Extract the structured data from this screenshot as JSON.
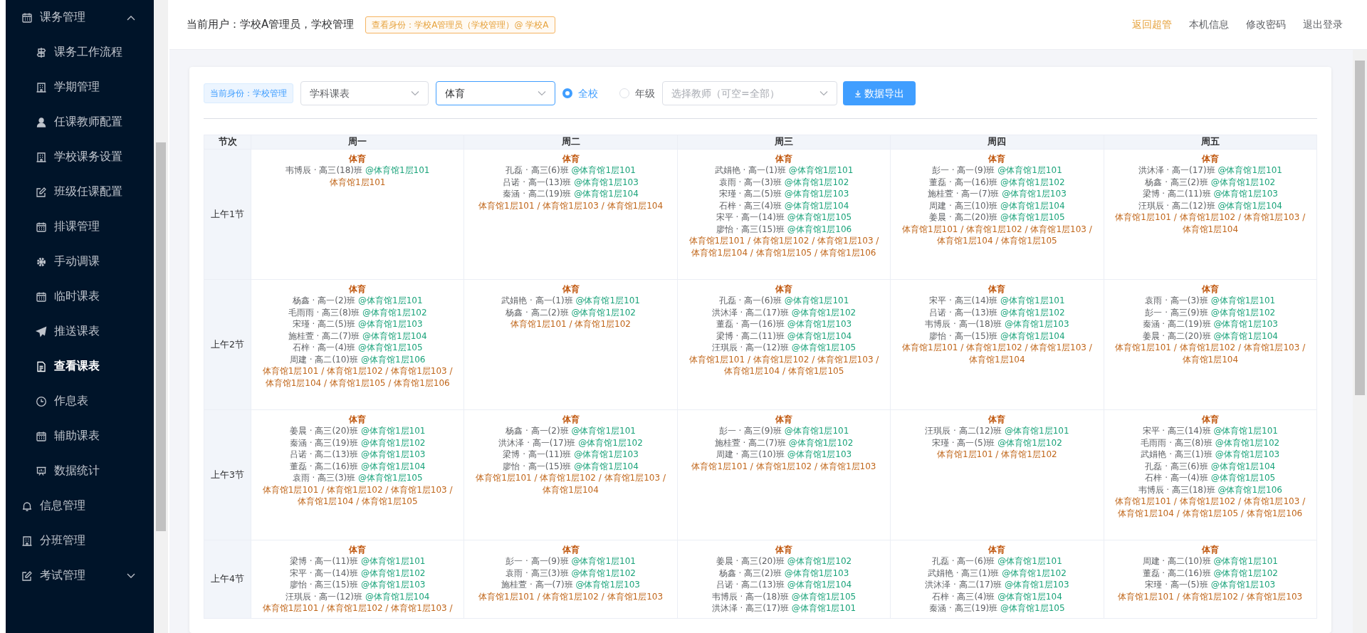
{
  "sidebar": {
    "items": [
      {
        "kind": "group",
        "label": "课务管理",
        "expanded": true,
        "selected": false,
        "children": [
          {
            "label": "课务工作流程",
            "selected": false
          },
          {
            "label": "学期管理",
            "selected": false
          },
          {
            "label": "任课教师配置",
            "selected": false
          },
          {
            "label": "学校课务设置",
            "selected": false
          },
          {
            "label": "班级任课配置",
            "selected": false
          },
          {
            "label": "排课管理",
            "selected": false
          },
          {
            "label": "手动调课",
            "selected": false
          },
          {
            "label": "临时课表",
            "selected": false
          },
          {
            "label": "推送课表",
            "selected": false
          },
          {
            "label": "查看课表",
            "selected": true
          },
          {
            "label": "作息表",
            "selected": false
          },
          {
            "label": "辅助课表",
            "selected": false
          },
          {
            "label": "数据统计",
            "selected": false
          }
        ]
      },
      {
        "kind": "link",
        "label": "信息管理",
        "selected": false
      },
      {
        "kind": "link",
        "label": "分班管理",
        "selected": false
      },
      {
        "kind": "group",
        "label": "考试管理",
        "expanded": false,
        "selected": false
      }
    ]
  },
  "header": {
    "user_text": "当前用户：学校A管理员，学校管理",
    "identity_badge": "查看身份：学校A管理员（学校管理）@ 学校A",
    "links": [
      {
        "label": "返回超管",
        "highlighted": true
      },
      {
        "label": "本机信息",
        "highlighted": false
      },
      {
        "label": "修改密码",
        "highlighted": false
      },
      {
        "label": "退出登录",
        "highlighted": false
      }
    ]
  },
  "toolbar": {
    "identity_tag": "当前身份：学校管理",
    "table_type": {
      "value": "学科课表",
      "focused": false
    },
    "subject": {
      "value": "体育",
      "focused": true
    },
    "scope": [
      {
        "label": "全校",
        "selected": true
      },
      {
        "label": "年级",
        "selected": false
      }
    ],
    "teacher": {
      "placeholder": "选择教师（可空=全部）"
    },
    "export_button": "数据导出"
  },
  "table": {
    "period_header": "节次",
    "columns": [
      "周一",
      "周二",
      "周三",
      "周四",
      "周五"
    ],
    "rows": [
      {
        "period": "上午1节",
        "cells": [
          {
            "subject": "体育",
            "entries": [
              {
                "who": "韦博辰 · 高三(18)班",
                "room": "@体育馆1层101"
              }
            ],
            "rooms": "体育馆1层101"
          },
          {
            "subject": "体育",
            "entries": [
              {
                "who": "孔磊 · 高三(6)班",
                "room": "@体育馆1层101"
              },
              {
                "who": "吕诺 · 高一(13)班",
                "room": "@体育馆1层103"
              },
              {
                "who": "秦涵 · 高二(19)班",
                "room": "@体育馆1层104"
              }
            ],
            "rooms": "体育馆1层101 / 体育馆1层103 / 体育馆1层104"
          },
          {
            "subject": "体育",
            "entries": [
              {
                "who": "武娟艳 · 高一(1)班",
                "room": "@体育馆1层101"
              },
              {
                "who": "袁雨 · 高一(3)班",
                "room": "@体育馆1层102"
              },
              {
                "who": "宋瑾 · 高二(5)班",
                "room": "@体育馆1层103"
              },
              {
                "who": "石梓 · 高三(4)班",
                "room": "@体育馆1层104"
              },
              {
                "who": "宋平 · 高一(14)班",
                "room": "@体育馆1层105"
              },
              {
                "who": "廖怡 · 高三(15)班",
                "room": "@体育馆1层106"
              }
            ],
            "rooms": "体育馆1层101 / 体育馆1层102 / 体育馆1层103 / 体育馆1层104 / 体育馆1层105 / 体育馆1层106"
          },
          {
            "subject": "体育",
            "entries": [
              {
                "who": "彭一 · 高一(9)班",
                "room": "@体育馆1层101"
              },
              {
                "who": "董磊 · 高一(16)班",
                "room": "@体育馆1层102"
              },
              {
                "who": "施桂萱 · 高一(7)班",
                "room": "@体育馆1层103"
              },
              {
                "who": "周建 · 高三(10)班",
                "room": "@体育馆1层104"
              },
              {
                "who": "姜晨 · 高二(20)班",
                "room": "@体育馆1层105"
              }
            ],
            "rooms": "体育馆1层101 / 体育馆1层102 / 体育馆1层103 / 体育馆1层104 / 体育馆1层105"
          },
          {
            "subject": "体育",
            "entries": [
              {
                "who": "洪沐泽 · 高一(17)班",
                "room": "@体育馆1层101"
              },
              {
                "who": "杨鑫 · 高三(2)班",
                "room": "@体育馆1层102"
              },
              {
                "who": "梁博 · 高二(11)班",
                "room": "@体育馆1层103"
              },
              {
                "who": "汪琪辰 · 高二(12)班",
                "room": "@体育馆1层104"
              }
            ],
            "rooms": "体育馆1层101 / 体育馆1层102 / 体育馆1层103 / 体育馆1层104"
          }
        ]
      },
      {
        "period": "上午2节",
        "cells": [
          {
            "subject": "体育",
            "entries": [
              {
                "who": "杨鑫 · 高一(2)班",
                "room": "@体育馆1层101"
              },
              {
                "who": "毛雨雨 · 高三(8)班",
                "room": "@体育馆1层102"
              },
              {
                "who": "宋瑾 · 高二(5)班",
                "room": "@体育馆1层103"
              },
              {
                "who": "施桂萱 · 高二(7)班",
                "room": "@体育馆1层104"
              },
              {
                "who": "石梓 · 高一(4)班",
                "room": "@体育馆1层105"
              },
              {
                "who": "周建 · 高二(10)班",
                "room": "@体育馆1层106"
              }
            ],
            "rooms": "体育馆1层101 / 体育馆1层102 / 体育馆1层103 / 体育馆1层104 / 体育馆1层105 / 体育馆1层106"
          },
          {
            "subject": "体育",
            "entries": [
              {
                "who": "武娟艳 · 高一(1)班",
                "room": "@体育馆1层101"
              },
              {
                "who": "杨鑫 · 高二(2)班",
                "room": "@体育馆1层102"
              }
            ],
            "rooms": "体育馆1层101 / 体育馆1层102"
          },
          {
            "subject": "体育",
            "entries": [
              {
                "who": "孔磊 · 高一(6)班",
                "room": "@体育馆1层101"
              },
              {
                "who": "洪沐泽 · 高二(17)班",
                "room": "@体育馆1层102"
              },
              {
                "who": "董磊 · 高一(16)班",
                "room": "@体育馆1层103"
              },
              {
                "who": "梁博 · 高二(11)班",
                "room": "@体育馆1层104"
              },
              {
                "who": "汪琪辰 · 高一(12)班",
                "room": "@体育馆1层105"
              }
            ],
            "rooms": "体育馆1层101 / 体育馆1层102 / 体育馆1层103 / 体育馆1层104 / 体育馆1层105"
          },
          {
            "subject": "体育",
            "entries": [
              {
                "who": "宋平 · 高三(14)班",
                "room": "@体育馆1层101"
              },
              {
                "who": "吕诺 · 高一(13)班",
                "room": "@体育馆1层102"
              },
              {
                "who": "韦博辰 · 高一(18)班",
                "room": "@体育馆1层103"
              },
              {
                "who": "廖怡 · 高一(15)班",
                "room": "@体育馆1层104"
              }
            ],
            "rooms": "体育馆1层101 / 体育馆1层102 / 体育馆1层103 / 体育馆1层104"
          },
          {
            "subject": "体育",
            "entries": [
              {
                "who": "袁雨 · 高一(3)班",
                "room": "@体育馆1层101"
              },
              {
                "who": "彭一 · 高三(9)班",
                "room": "@体育馆1层102"
              },
              {
                "who": "秦涵 · 高二(19)班",
                "room": "@体育馆1层103"
              },
              {
                "who": "姜晨 · 高二(20)班",
                "room": "@体育馆1层104"
              }
            ],
            "rooms": "体育馆1层101 / 体育馆1层102 / 体育馆1层103 / 体育馆1层104"
          }
        ]
      },
      {
        "period": "上午3节",
        "cells": [
          {
            "subject": "体育",
            "entries": [
              {
                "who": "姜晨 · 高三(20)班",
                "room": "@体育馆1层101"
              },
              {
                "who": "秦涵 · 高三(19)班",
                "room": "@体育馆1层102"
              },
              {
                "who": "吕诺 · 高二(13)班",
                "room": "@体育馆1层103"
              },
              {
                "who": "董磊 · 高二(16)班",
                "room": "@体育馆1层104"
              },
              {
                "who": "袁雨 · 高三(3)班",
                "room": "@体育馆1层105"
              }
            ],
            "rooms": "体育馆1层101 / 体育馆1层102 / 体育馆1层103 / 体育馆1层104 / 体育馆1层105"
          },
          {
            "subject": "体育",
            "entries": [
              {
                "who": "杨鑫 · 高一(2)班",
                "room": "@体育馆1层101"
              },
              {
                "who": "洪沐泽 · 高一(17)班",
                "room": "@体育馆1层102"
              },
              {
                "who": "梁博 · 高一(11)班",
                "room": "@体育馆1层103"
              },
              {
                "who": "廖怡 · 高一(15)班",
                "room": "@体育馆1层104"
              }
            ],
            "rooms": "体育馆1层101 / 体育馆1层102 / 体育馆1层103 / 体育馆1层104"
          },
          {
            "subject": "体育",
            "entries": [
              {
                "who": "彭一 · 高三(9)班",
                "room": "@体育馆1层101"
              },
              {
                "who": "施桂萱 · 高二(7)班",
                "room": "@体育馆1层102"
              },
              {
                "who": "周建 · 高三(10)班",
                "room": "@体育馆1层103"
              }
            ],
            "rooms": "体育馆1层101 / 体育馆1层102 / 体育馆1层103"
          },
          {
            "subject": "体育",
            "entries": [
              {
                "who": "汪琪辰 · 高二(12)班",
                "room": "@体育馆1层101"
              },
              {
                "who": "宋瑾 · 高一(5)班",
                "room": "@体育馆1层102"
              }
            ],
            "rooms": "体育馆1层101 / 体育馆1层102"
          },
          {
            "subject": "体育",
            "entries": [
              {
                "who": "宋平 · 高三(14)班",
                "room": "@体育馆1层101"
              },
              {
                "who": "毛雨雨 · 高三(8)班",
                "room": "@体育馆1层102"
              },
              {
                "who": "武娟艳 · 高三(1)班",
                "room": "@体育馆1层103"
              },
              {
                "who": "孔磊 · 高三(6)班",
                "room": "@体育馆1层104"
              },
              {
                "who": "石梓 · 高一(4)班",
                "room": "@体育馆1层105"
              },
              {
                "who": "韦博辰 · 高三(18)班",
                "room": "@体育馆1层106"
              }
            ],
            "rooms": "体育馆1层101 / 体育馆1层102 / 体育馆1层103 / 体育馆1层104 / 体育馆1层105 / 体育馆1层106"
          }
        ]
      },
      {
        "period": "上午4节",
        "cells": [
          {
            "subject": "体育",
            "entries": [
              {
                "who": "梁博 · 高一(11)班",
                "room": "@体育馆1层101"
              },
              {
                "who": "宋平 · 高一(14)班",
                "room": "@体育馆1层102"
              },
              {
                "who": "廖怡 · 高三(15)班",
                "room": "@体育馆1层103"
              },
              {
                "who": "汪琪辰 · 高一(12)班",
                "room": "@体育馆1层104"
              }
            ],
            "rooms": "体育馆1层101 / 体育馆1层102 / 体育馆1层103 /"
          },
          {
            "subject": "体育",
            "entries": [
              {
                "who": "彭一 · 高一(9)班",
                "room": "@体育馆1层101"
              },
              {
                "who": "袁雨 · 高三(3)班",
                "room": "@体育馆1层102"
              },
              {
                "who": "施桂萱 · 高一(7)班",
                "room": "@体育馆1层103"
              }
            ],
            "rooms": "体育馆1层101 / 体育馆1层102 / 体育馆1层103"
          },
          {
            "subject": "体育",
            "entries": [
              {
                "who": "姜晨 · 高三(20)班",
                "room": "@体育馆1层102"
              },
              {
                "who": "杨鑫 · 高三(2)班",
                "room": "@体育馆1层103"
              },
              {
                "who": "吕诺 · 高二(13)班",
                "room": "@体育馆1层104"
              },
              {
                "who": "韦博辰 · 高一(18)班",
                "room": "@体育馆1层105"
              },
              {
                "who": "洪沐泽 · 高三(17)班",
                "room": "@体育馆1层101"
              }
            ]
          },
          {
            "subject": "体育",
            "entries": [
              {
                "who": "孔磊 · 高一(6)班",
                "room": "@体育馆1层101"
              },
              {
                "who": "武娟艳 · 高三(1)班",
                "room": "@体育馆1层102"
              },
              {
                "who": "洪沐泽 · 高二(17)班",
                "room": "@体育馆1层103"
              },
              {
                "who": "石梓 · 高三(4)班",
                "room": "@体育馆1层104"
              },
              {
                "who": "秦涵 · 高三(19)班",
                "room": "@体育馆1层105"
              }
            ]
          },
          {
            "subject": "体育",
            "entries": [
              {
                "who": "周建 · 高二(10)班",
                "room": "@体育馆1层101"
              },
              {
                "who": "董磊 · 高二(16)班",
                "room": "@体育馆1层102"
              },
              {
                "who": "宋瑾 · 高一(5)班",
                "room": "@体育馆1层103"
              }
            ],
            "rooms": "体育馆1层101 / 体育馆1层102 / 体育馆1层103"
          }
        ]
      }
    ]
  }
}
